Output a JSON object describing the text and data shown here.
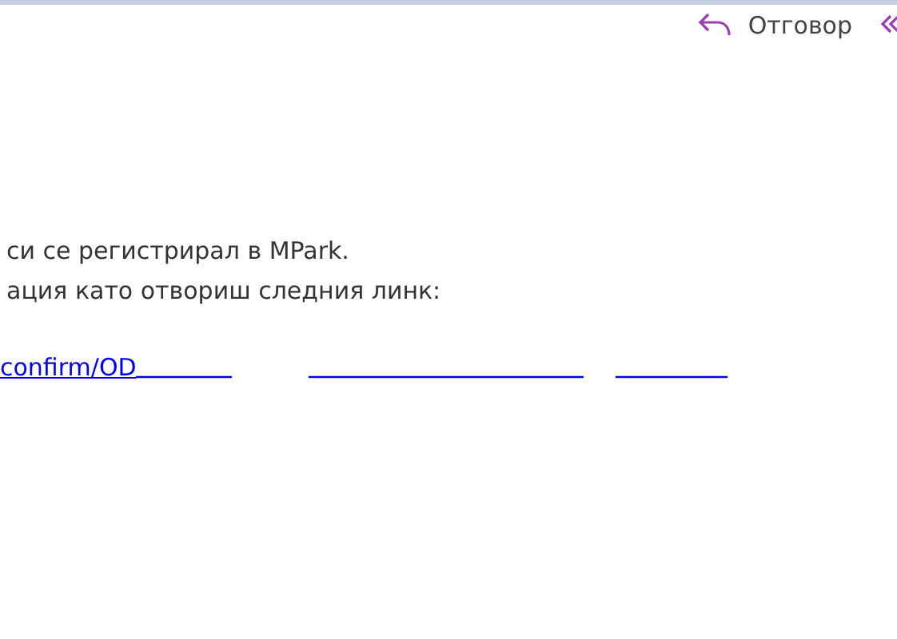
{
  "toolbar": {
    "reply": {
      "label": "Отговор"
    }
  },
  "body": {
    "lines": [
      "си се регистрирал в MPark.",
      "ация като отвориш следния линк:"
    ],
    "link": "confirm/OD"
  }
}
